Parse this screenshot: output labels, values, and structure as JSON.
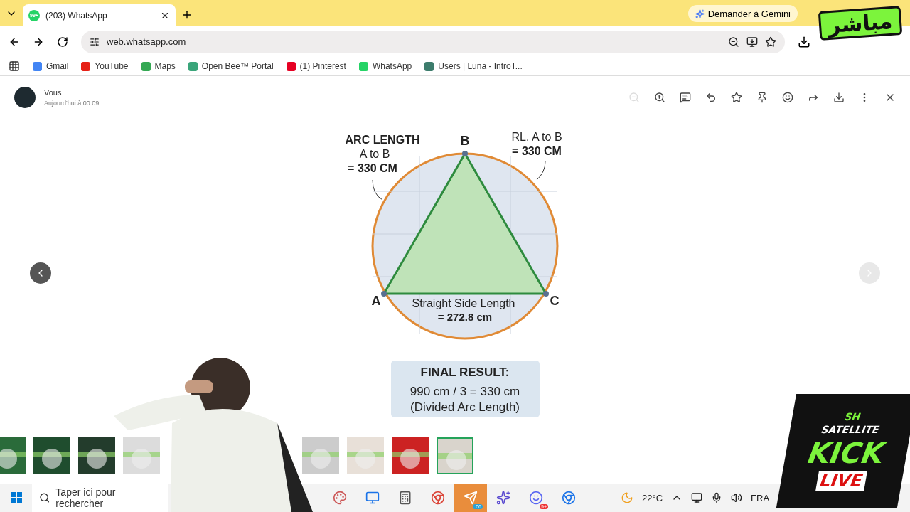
{
  "browser": {
    "tabs": [
      {
        "title": "(203) WhatsApp",
        "badge": "99+",
        "selected": true
      }
    ],
    "gemini_button": "Demander à Gemini",
    "address": "web.whatsapp.com",
    "bookmarks": [
      {
        "label": "Gmail",
        "color": "#4285f4"
      },
      {
        "label": "YouTube",
        "color": "#e62117"
      },
      {
        "label": "Maps",
        "color": "#34a853"
      },
      {
        "label": "Open Bee™ Portal",
        "color": "#3aa57a"
      },
      {
        "label": "(1) Pinterest",
        "color": "#e60023"
      },
      {
        "label": "WhatsApp",
        "color": "#25d366"
      },
      {
        "label": "Users | Luna - IntroT...",
        "color": "#3c7c6c"
      }
    ]
  },
  "viewer": {
    "sender": "Vous",
    "time": "Aujourd'hui à 00:09",
    "diagram": {
      "arc_title": "ARC LENGTH",
      "arc_sub": "A to B",
      "arc_value": "= 330 CM",
      "rl_title": "RL. A to B",
      "rl_value": "= 330 CM",
      "point_a": "A",
      "point_b": "B",
      "point_c": "C",
      "side_label": "Straight Side Length",
      "side_value": "= 272.8 cm",
      "result_title": "FINAL RESULT:",
      "result_line": "990 cm / 3 = 330 cm",
      "result_note": "(Divided Arc Length)"
    },
    "thumbnails": [
      {
        "selected": false
      },
      {
        "selected": false
      },
      {
        "selected": false
      },
      {
        "selected": false
      },
      {
        "selected": false
      },
      {
        "selected": false
      },
      {
        "selected": false
      },
      {
        "selected": true
      }
    ]
  },
  "taskbar": {
    "search_placeholder": "Taper ici pour rechercher",
    "telegram_badge": ".06",
    "messenger_badge": "9+",
    "temperature": "22°C",
    "language": "FRA"
  },
  "overlay": {
    "live_badge": "مباشر",
    "channel_top": "SH",
    "channel_sub": "SATELLITE",
    "channel_name": "KICK",
    "live": "LIVE"
  }
}
